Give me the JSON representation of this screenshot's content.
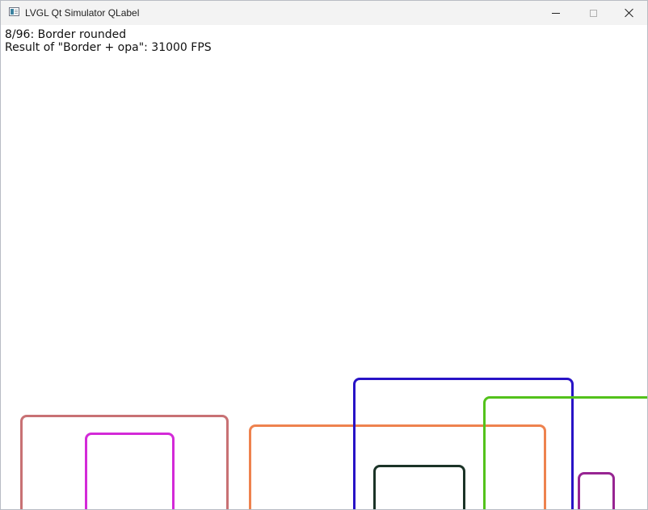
{
  "window": {
    "title": "LVGL Qt Simulator QLabel",
    "icon": "app-window-icon"
  },
  "controls": {
    "minimize_icon": "minimize-icon",
    "maximize_icon": "maximize-icon",
    "close_icon": "close-icon"
  },
  "benchmark": {
    "scene_line": "8/96: Border rounded",
    "result_line": "Result of \"Border + opa\": 31000 FPS"
  },
  "shapes": {
    "kind": "rounded-border-rectangles",
    "colors": [
      "#c87174",
      "#d32ad8",
      "#ee824e",
      "#2813c6",
      "#53c21b",
      "#1b3327",
      "#972592"
    ]
  }
}
